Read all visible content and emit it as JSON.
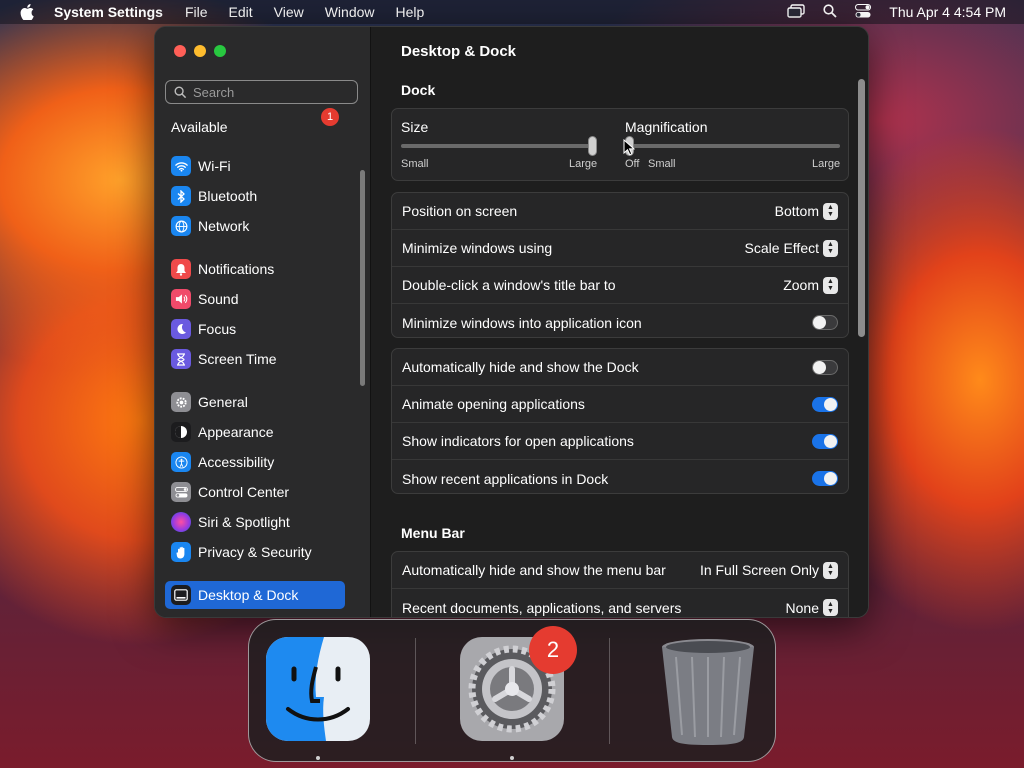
{
  "menubar": {
    "app_name": "System Settings",
    "menus": [
      "File",
      "Edit",
      "View",
      "Window",
      "Help"
    ],
    "clock": "Thu Apr 4  4:54 PM"
  },
  "sidebar": {
    "search_placeholder": "Search",
    "partial_item": {
      "label": "Available",
      "badge": "1"
    },
    "items": [
      {
        "label": "Wi-Fi",
        "icon": "wifi-icon",
        "color": "#1a86f0"
      },
      {
        "label": "Bluetooth",
        "icon": "bluetooth-icon",
        "color": "#1a86f0"
      },
      {
        "label": "Network",
        "icon": "globe-icon",
        "color": "#1a86f0"
      },
      {
        "label": "Notifications",
        "icon": "bell-icon",
        "color": "#f04a4a"
      },
      {
        "label": "Sound",
        "icon": "speaker-icon",
        "color": "#f04a6a"
      },
      {
        "label": "Focus",
        "icon": "moon-icon",
        "color": "#6a5ae0"
      },
      {
        "label": "Screen Time",
        "icon": "hourglass-icon",
        "color": "#6a5ae0"
      },
      {
        "label": "General",
        "icon": "gear-icon",
        "color": "#8e8e93"
      },
      {
        "label": "Appearance",
        "icon": "appearance-icon",
        "color": "#1c1c1e"
      },
      {
        "label": "Accessibility",
        "icon": "accessibility-icon",
        "color": "#1a86f0"
      },
      {
        "label": "Control Center",
        "icon": "control-center-icon",
        "color": "#8e8e93"
      },
      {
        "label": "Siri & Spotlight",
        "icon": "siri-icon",
        "color": "#9a3ae0"
      },
      {
        "label": "Privacy & Security",
        "icon": "hand-icon",
        "color": "#1a86f0"
      },
      {
        "label": "Desktop & Dock",
        "icon": "desktop-icon",
        "color": "#1c1c1e",
        "active": true
      }
    ]
  },
  "content": {
    "title": "Desktop & Dock",
    "dock_section": "Dock",
    "size": {
      "label": "Size",
      "min": "Small",
      "max": "Large",
      "value": 1.0
    },
    "magnification": {
      "label": "Magnification",
      "off": "Off",
      "min": "Small",
      "max": "Large",
      "value": 0.0
    },
    "dock_rows": [
      {
        "label": "Position on screen",
        "value": "Bottom"
      },
      {
        "label": "Minimize windows using",
        "value": "Scale Effect"
      },
      {
        "label": "Double-click a window's title bar to",
        "value": "Zoom"
      },
      {
        "label": "Minimize windows into application icon",
        "toggle": false
      }
    ],
    "dock_toggles": [
      {
        "label": "Automatically hide and show the Dock",
        "toggle": false
      },
      {
        "label": "Animate opening applications",
        "toggle": true
      },
      {
        "label": "Show indicators for open applications",
        "toggle": true
      },
      {
        "label": "Show recent applications in Dock",
        "toggle": true
      }
    ],
    "menubar_section": "Menu Bar",
    "menubar_rows": [
      {
        "label": "Automatically hide and show the menu bar",
        "value": "In Full Screen Only"
      },
      {
        "label": "Recent documents, applications, and servers",
        "value": "None"
      }
    ]
  },
  "dock": {
    "apps": [
      {
        "name": "finder-app-icon"
      },
      {
        "name": "system-settings-app-icon",
        "badge": "2"
      },
      {
        "name": "trash-icon"
      }
    ]
  }
}
